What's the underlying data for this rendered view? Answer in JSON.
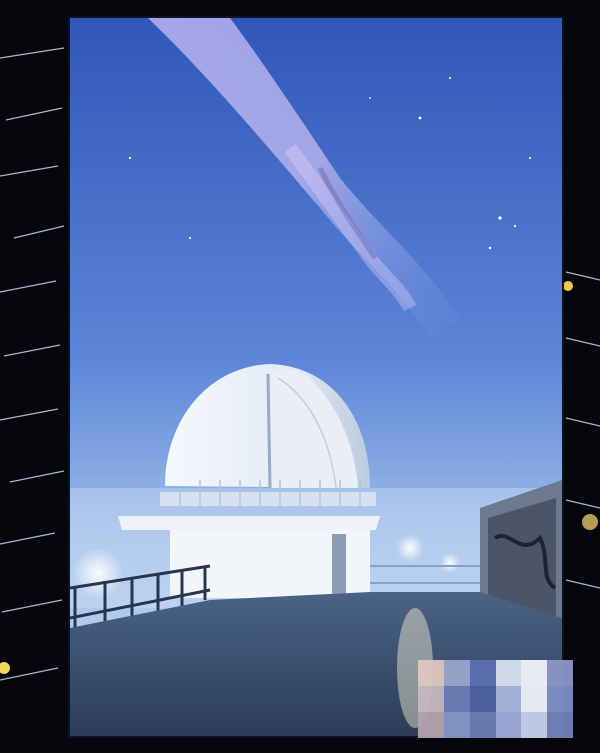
{
  "image": {
    "subject": "observatory-dome-under-night-sky",
    "icons": [
      "milky-way",
      "telescope-dome",
      "railing",
      "star-trail"
    ]
  },
  "colors": {
    "background": "#05070d",
    "sky_top": "#2f57b8",
    "sky_mid": "#5d86d8",
    "sky_horizon": "#a8c6ee",
    "dome": "#eef2f8",
    "deck": "#3d5270",
    "mosaic_light": "#dbe5f3",
    "mosaic_mid": "#8e9cc0",
    "mosaic_dark": "#4f61a0"
  }
}
